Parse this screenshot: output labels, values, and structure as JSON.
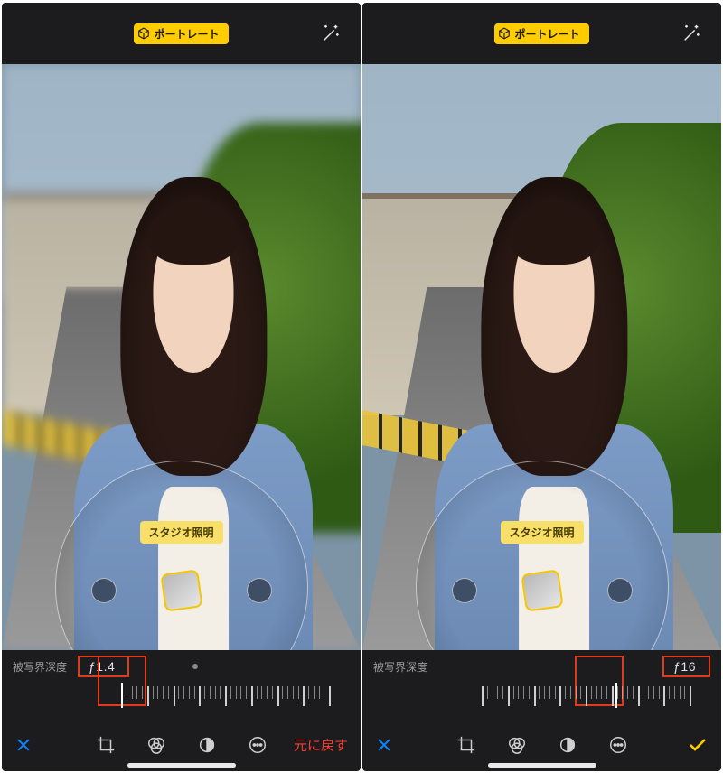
{
  "left": {
    "mode_badge": "ポートレート",
    "lighting_label": "スタジオ照明",
    "depth_label": "被写界深度",
    "f_value": "ƒ1.4",
    "revert": "元に戻す",
    "icons": {
      "cancel": "cancel-icon",
      "crop": "crop-icon",
      "filters": "filters-icon",
      "adjust": "adjust-icon",
      "more": "more-icon",
      "wand": "wand-icon",
      "cube": "cube-icon"
    }
  },
  "right": {
    "mode_badge": "ポートレート",
    "lighting_label": "スタジオ照明",
    "depth_label": "被写界深度",
    "f_value": "ƒ16",
    "icons": {
      "cancel": "cancel-icon",
      "crop": "crop-icon",
      "filters": "filters-icon",
      "adjust": "adjust-icon",
      "more": "more-icon",
      "done": "done-icon",
      "wand": "wand-icon",
      "cube": "cube-icon"
    }
  },
  "colors": {
    "accent_yellow": "#ffcc00",
    "revert_red": "#ff3b30",
    "highlight_box": "#e23b1c",
    "cancel_blue": "#0a84ff"
  }
}
